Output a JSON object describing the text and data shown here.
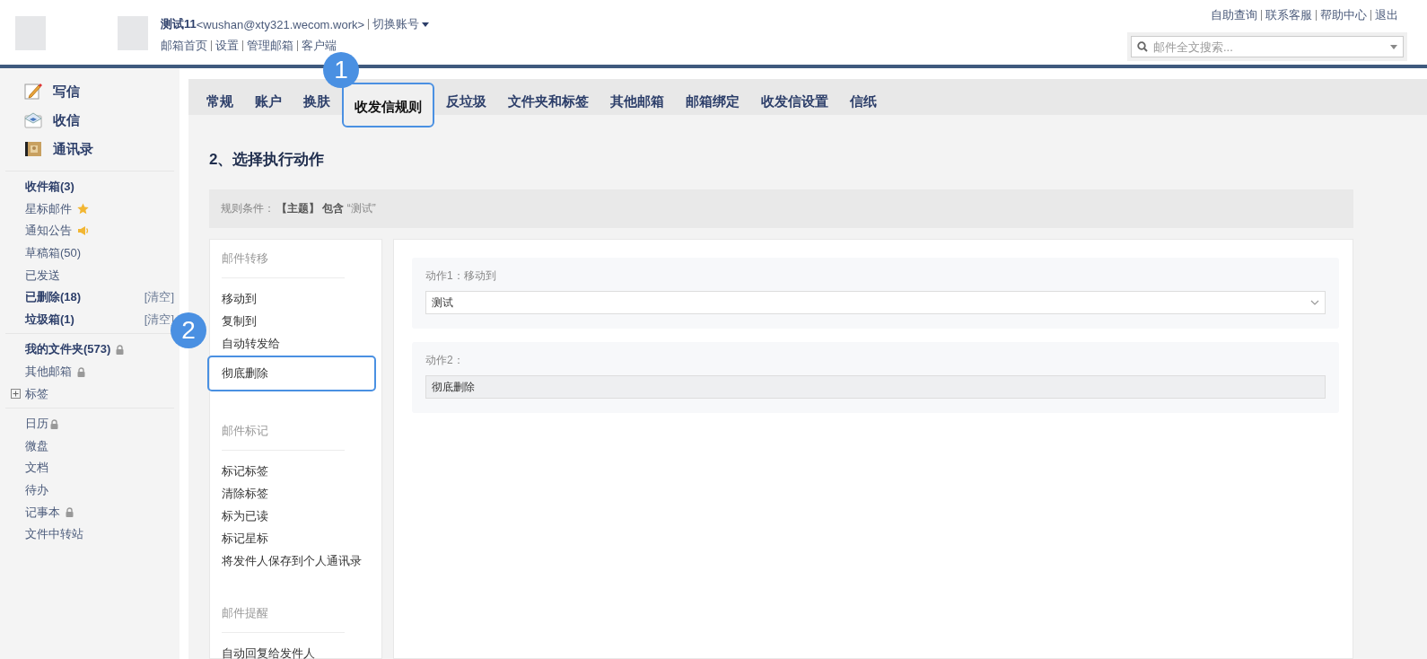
{
  "header": {
    "account_name": "测试11",
    "account_email": "<wushan@xty321.wecom.work>",
    "switch_account": "切换账号",
    "nav_links": [
      "邮箱首页",
      "设置",
      "管理邮箱",
      "客户端"
    ],
    "top_links": [
      "自助查询",
      "联系客服",
      "帮助中心",
      "退出"
    ],
    "search": {
      "placeholder": "邮件全文搜索..."
    }
  },
  "sidebar": {
    "actions": [
      {
        "label": "写信",
        "kind": "write"
      },
      {
        "label": "收信",
        "kind": "receive"
      },
      {
        "label": "通讯录",
        "kind": "contacts"
      }
    ],
    "groups": [
      {
        "items": [
          {
            "label": "收件箱(3)",
            "bold": true
          },
          {
            "label": "星标邮件",
            "bold": false,
            "kind": "star"
          },
          {
            "label": "通知公告",
            "bold": false,
            "kind": "speaker"
          },
          {
            "label": "草稿箱(50)",
            "bold": false
          },
          {
            "label": "已发送",
            "bold": false
          },
          {
            "label": "已删除(18)",
            "bold": true,
            "action": "[清空]"
          },
          {
            "label": "垃圾箱(1)",
            "bold": true,
            "action": "[清空]"
          }
        ]
      },
      {
        "items": [
          {
            "label": "我的文件夹(573)",
            "bold": true,
            "kind": "lock"
          },
          {
            "label": "其他邮箱",
            "bold": false,
            "kind": "lock"
          },
          {
            "label": "标签",
            "bold": false,
            "kind": "expand",
            "expanded": false
          }
        ]
      },
      {
        "items": [
          {
            "label": "日历",
            "bold": false,
            "kind": "lock"
          },
          {
            "label": "微盘",
            "bold": false
          },
          {
            "label": "文档",
            "bold": false
          },
          {
            "label": "待办",
            "bold": false
          },
          {
            "label": "记事本",
            "bold": false,
            "kind": "lock"
          },
          {
            "label": "文件中转站",
            "bold": false
          }
        ]
      }
    ]
  },
  "tabs": [
    {
      "label": "常规",
      "selected": false
    },
    {
      "label": "账户",
      "selected": false
    },
    {
      "label": "换肤",
      "selected": false
    },
    {
      "label": "收发信规则",
      "selected": true,
      "badge": "1"
    },
    {
      "label": "反垃圾",
      "selected": false
    },
    {
      "label": "文件夹和标签",
      "selected": false
    },
    {
      "label": "其他邮箱",
      "selected": false
    },
    {
      "label": "邮箱绑定",
      "selected": false
    },
    {
      "label": "收发信设置",
      "selected": false
    },
    {
      "label": "信纸",
      "selected": false
    }
  ],
  "page_title": "2、选择执行动作",
  "condition": {
    "label": "规则条件：",
    "text": "**【主题】 包含** “测试”"
  },
  "action_groups": [
    {
      "heading": "邮件转移",
      "items": [
        {
          "label": "移动到",
          "highlighted": false
        },
        {
          "label": "复制到",
          "highlighted": false
        },
        {
          "label": "自动转发给",
          "highlighted": false
        },
        {
          "label": "彻底删除",
          "highlighted": true,
          "badge": "2"
        }
      ]
    },
    {
      "heading": "邮件标记",
      "items": [
        {
          "label": "标记标签",
          "highlighted": false
        },
        {
          "label": "清除标签",
          "highlighted": false
        },
        {
          "label": "标为已读",
          "highlighted": false
        },
        {
          "label": "标记星标",
          "highlighted": false
        },
        {
          "label": "将发件人保存到个人通讯录",
          "highlighted": false
        }
      ]
    },
    {
      "heading": "邮件提醒",
      "items": [
        {
          "label": "自动回复给发件人",
          "highlighted": false
        }
      ]
    }
  ],
  "actions": [
    {
      "label": "动作1：移动到",
      "kind": "select",
      "value": "测试"
    },
    {
      "label": "动作2：",
      "kind": "readonly",
      "value": "彻底删除"
    }
  ]
}
